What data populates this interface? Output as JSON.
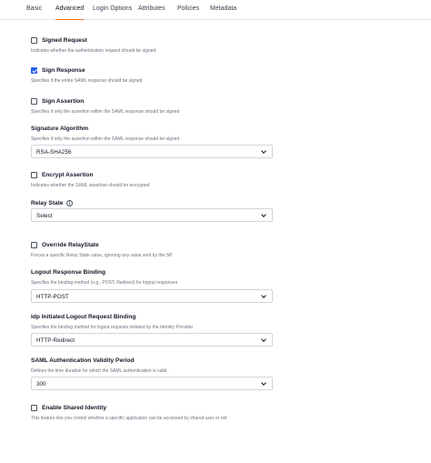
{
  "tabs": [
    {
      "label": "Basic"
    },
    {
      "label": "Advanced"
    },
    {
      "label": "Login Options"
    },
    {
      "label": "Attributes"
    },
    {
      "label": "Policies"
    },
    {
      "label": "Metadata"
    }
  ],
  "active_tab": "Advanced",
  "fields": {
    "signed_request": {
      "label": "Signed Request",
      "checked": false,
      "help": "Indicates whether the authentication request should be signed"
    },
    "sign_response": {
      "label": "Sign Response",
      "checked": true,
      "help": "Specifies if the entire SAML response should be signed"
    },
    "sign_assertion": {
      "label": "Sign Assertion",
      "checked": false,
      "help": "Specifies if only the assertion within the SAML response should be signed"
    },
    "signature_algorithm": {
      "label": "Signature Algorithm",
      "help": "Specifies if only the assertion within the SAML response should be signed",
      "value": "RSA-SHA256"
    },
    "encrypt_assertion": {
      "label": "Encrypt Assertion",
      "checked": false,
      "help": "Indicates whether the SAML assertion should be encrypted"
    },
    "relay_state": {
      "label": "Relay State",
      "value": "Select"
    },
    "override_relaystate": {
      "label": "Override RelayState",
      "checked": false,
      "help": "Forces a specific Relay State value, ignoring any value sent by the SP."
    },
    "logout_response_binding": {
      "label": "Logout Response Binding",
      "help": "Specifies the binding method (e.g., POST, Redirect) for logout responses",
      "value": "HTTP-POST"
    },
    "idp_logout_binding": {
      "label": "Idp Initiated Logout Request Binding",
      "help": "Specifies the binding method for logout requests initiated by the Identity Provider",
      "value": "HTTP-Redirect"
    },
    "saml_validity": {
      "label": "SAML Authentication Validity Period",
      "help": "Defines the time duration for which the SAML authentication is valid",
      "value": "300"
    },
    "shared_identity": {
      "label": "Enable Shared Identity",
      "checked": false,
      "help": "This feature lets you control whether a specific application can be accessed by shared user or not"
    }
  },
  "colors": {
    "accent": "#f97316",
    "checkbox_checked": "#2563eb"
  },
  "icons": {
    "info": "info-icon",
    "chevron": "chevron-down-icon",
    "check": "check-icon"
  }
}
